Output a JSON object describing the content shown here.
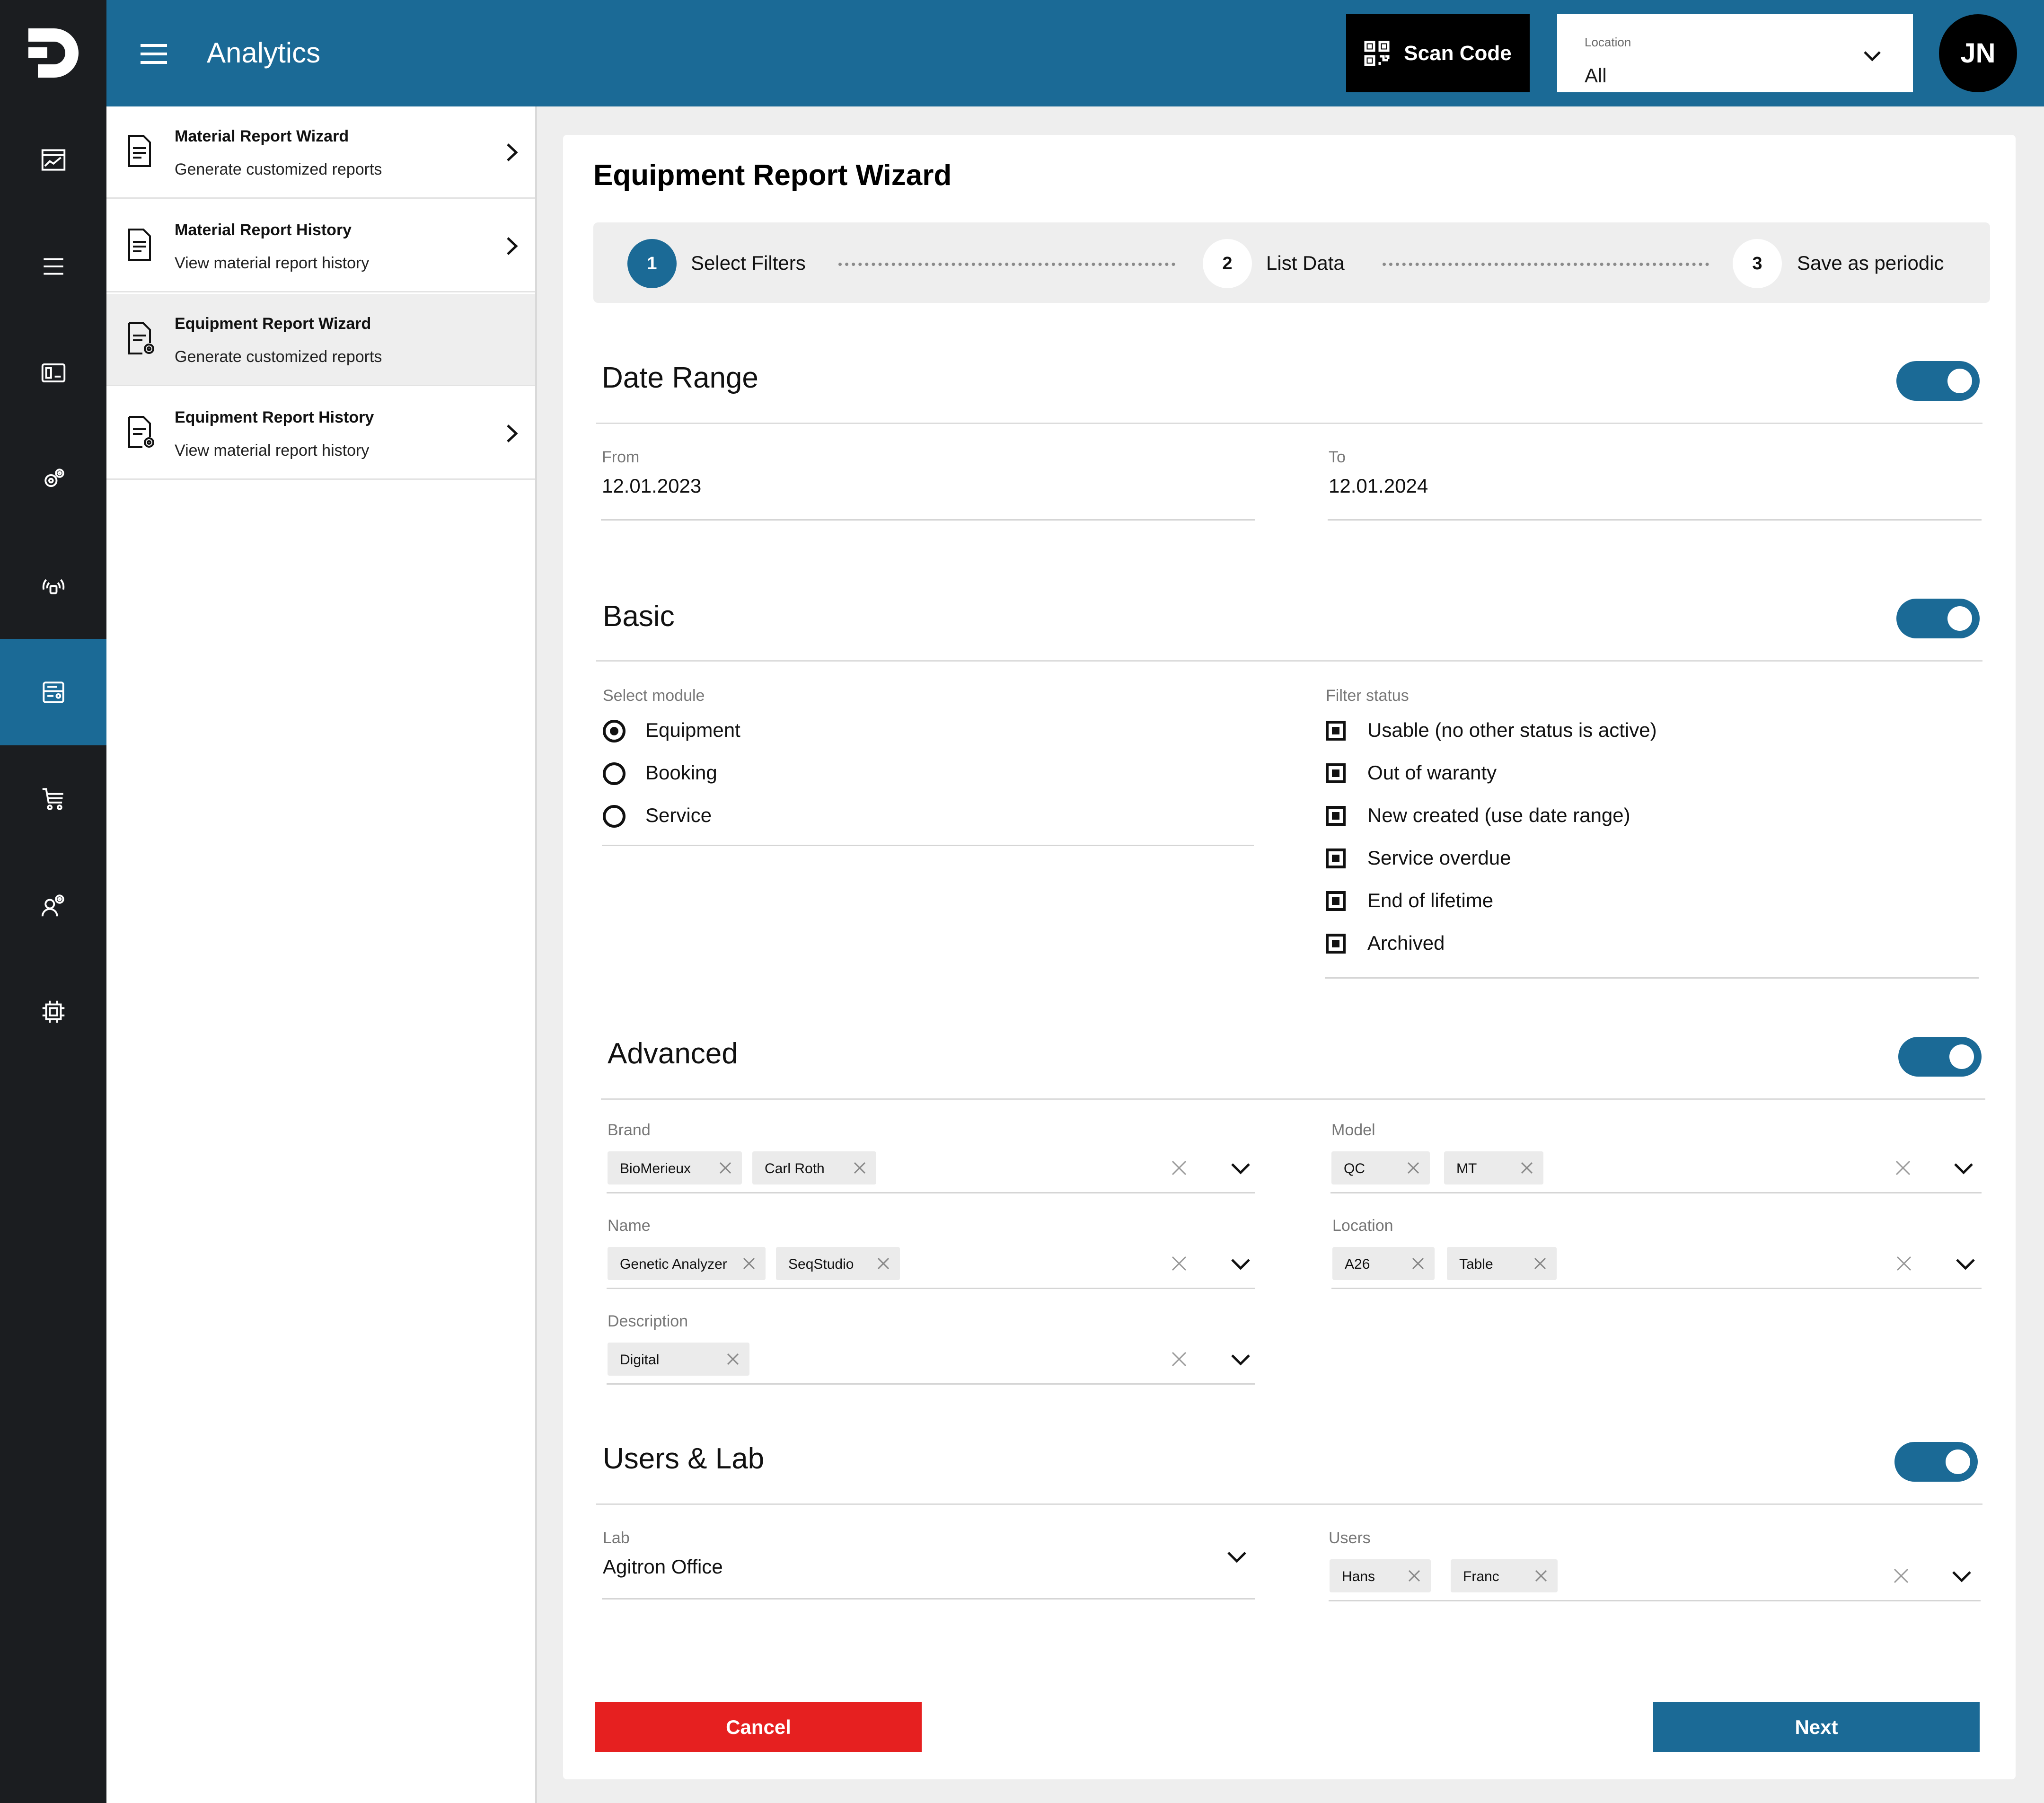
{
  "header": {
    "app_title": "Analytics",
    "scan_label": "Scan Code",
    "location_label": "Location",
    "location_value": "All",
    "avatar_initials": "JN"
  },
  "sidebar": {
    "items": [
      {
        "title": "Material Report Wizard",
        "subtitle": "Generate customized reports"
      },
      {
        "title": "Material Report History",
        "subtitle": "View material report history"
      },
      {
        "title": "Equipment Report Wizard",
        "subtitle": "Generate customized reports"
      },
      {
        "title": "Equipment Report History",
        "subtitle": "View material report history"
      }
    ]
  },
  "wizard": {
    "title": "Equipment Report Wizard",
    "steps": [
      {
        "number": "1",
        "label": "Select Filters"
      },
      {
        "number": "2",
        "label": "List Data"
      },
      {
        "number": "3",
        "label": "Save as periodic"
      }
    ],
    "date_range": {
      "title": "Date Range",
      "from_label": "From",
      "from_value": "12.01.2023",
      "to_label": "To",
      "to_value": "12.01.2024"
    },
    "basic": {
      "title": "Basic",
      "module_label": "Select module",
      "modules": [
        "Equipment",
        "Booking",
        "Service"
      ],
      "selected_module": "Equipment",
      "status_label": "Filter status",
      "statuses": [
        "Usable (no other status is active)",
        "Out of waranty",
        "New created (use date range)",
        "Service overdue",
        "End of lifetime",
        "Archived"
      ]
    },
    "advanced": {
      "title": "Advanced",
      "brand": {
        "label": "Brand",
        "chips": [
          "BioMerieux",
          "Carl Roth"
        ]
      },
      "model": {
        "label": "Model",
        "chips": [
          "QC",
          "MT"
        ]
      },
      "name": {
        "label": "Name",
        "chips": [
          "Genetic Analyzer",
          "SeqStudio"
        ]
      },
      "location": {
        "label": "Location",
        "chips": [
          "A26",
          "Table"
        ]
      },
      "description": {
        "label": "Description",
        "chips": [
          "Digital"
        ]
      }
    },
    "users_lab": {
      "title": "Users & Lab",
      "lab_label": "Lab",
      "lab_value": "Agitron Office",
      "users_label": "Users",
      "users_chips": [
        "Hans",
        "Franc"
      ]
    },
    "cancel_label": "Cancel",
    "next_label": "Next"
  },
  "colors": {
    "primary": "#1b6a96",
    "rail": "#1b1d20",
    "danger": "#e62020"
  }
}
